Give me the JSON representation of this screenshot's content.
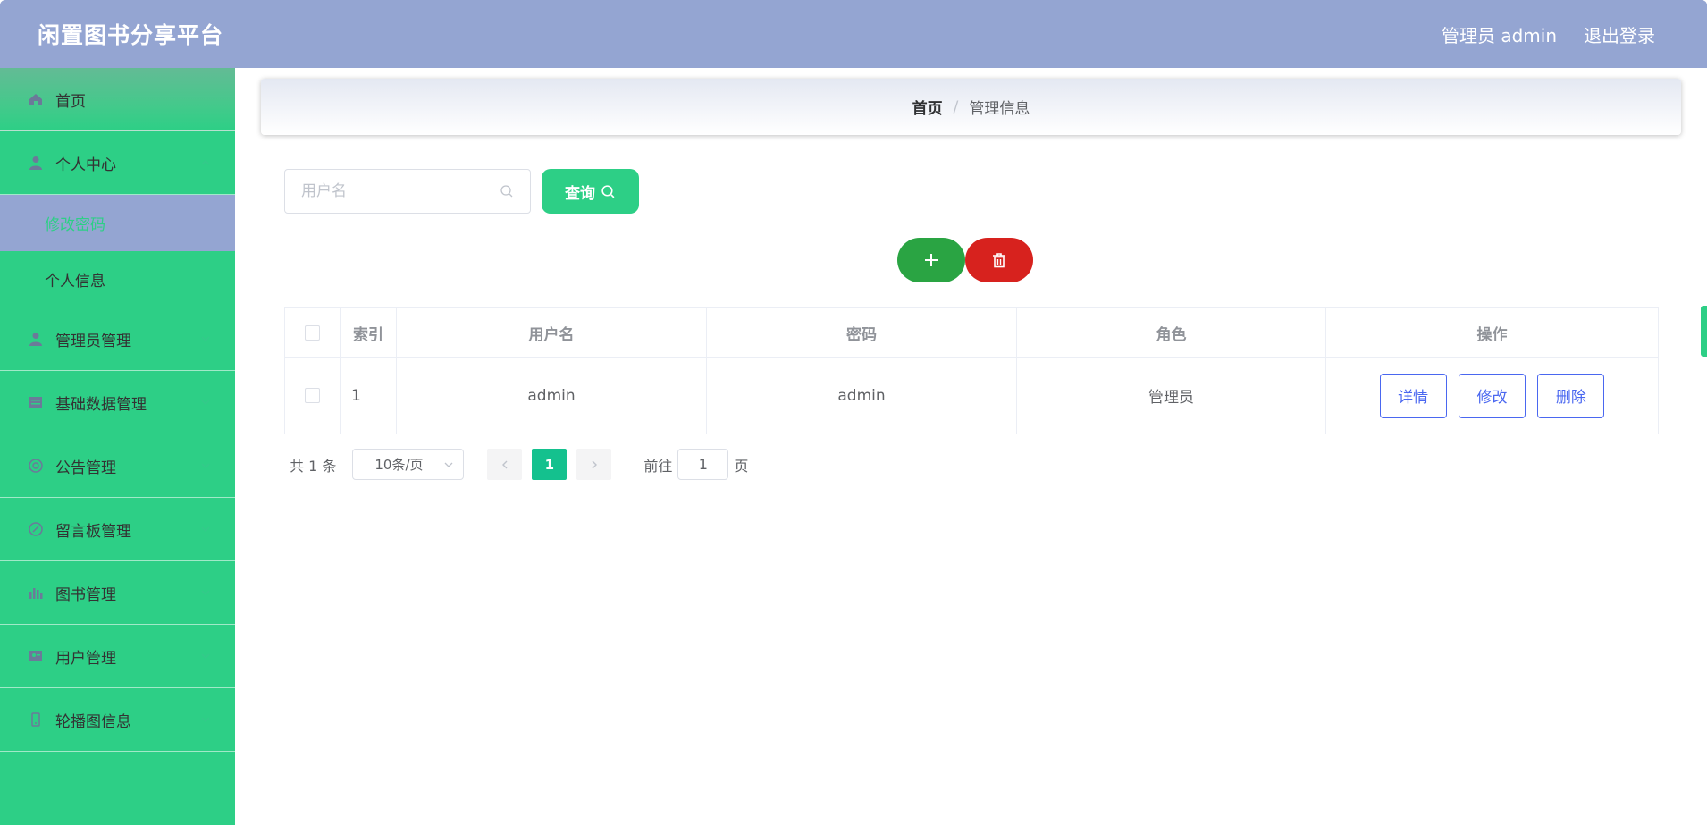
{
  "header": {
    "app_title": "闲置图书分享平台",
    "user_label": "管理员 admin",
    "logout_label": "退出登录"
  },
  "sidebar": {
    "items": [
      {
        "label": "首页",
        "icon": "home-icon"
      },
      {
        "label": "个人中心",
        "icon": "user-icon",
        "expanded": true,
        "children": [
          {
            "label": "修改密码",
            "active": true
          },
          {
            "label": "个人信息",
            "active": false
          }
        ]
      },
      {
        "label": "管理员管理",
        "icon": "user-icon"
      },
      {
        "label": "基础数据管理",
        "icon": "table-icon"
      },
      {
        "label": "公告管理",
        "icon": "notice-icon"
      },
      {
        "label": "留言板管理",
        "icon": "message-icon"
      },
      {
        "label": "图书管理",
        "icon": "chart-icon"
      },
      {
        "label": "用户管理",
        "icon": "users-icon"
      },
      {
        "label": "轮播图信息",
        "icon": "image-icon"
      }
    ]
  },
  "breadcrumb": {
    "home": "首页",
    "separator": "/",
    "current": "管理信息"
  },
  "search": {
    "placeholder": "用户名",
    "value": "",
    "button_label": "查询"
  },
  "table": {
    "headers": [
      "索引",
      "用户名",
      "密码",
      "角色",
      "操作"
    ],
    "rows": [
      {
        "index": "1",
        "username": "admin",
        "password": "admin",
        "role": "管理员"
      }
    ],
    "actions": [
      "详情",
      "修改",
      "删除"
    ]
  },
  "pagination": {
    "total_label": "共 1 条",
    "page_size_label": "10条/页",
    "current_page": "1",
    "goto_prefix": "前往",
    "goto_value": "1",
    "goto_suffix": "页"
  },
  "colors": {
    "header_bg": "#94a5d2",
    "sidebar_bg": "#2dcf86",
    "add_button": "#2aa443",
    "delete_button": "#d7221e",
    "action_button_border": "#4a67f0",
    "active_page": "#14c18e"
  }
}
